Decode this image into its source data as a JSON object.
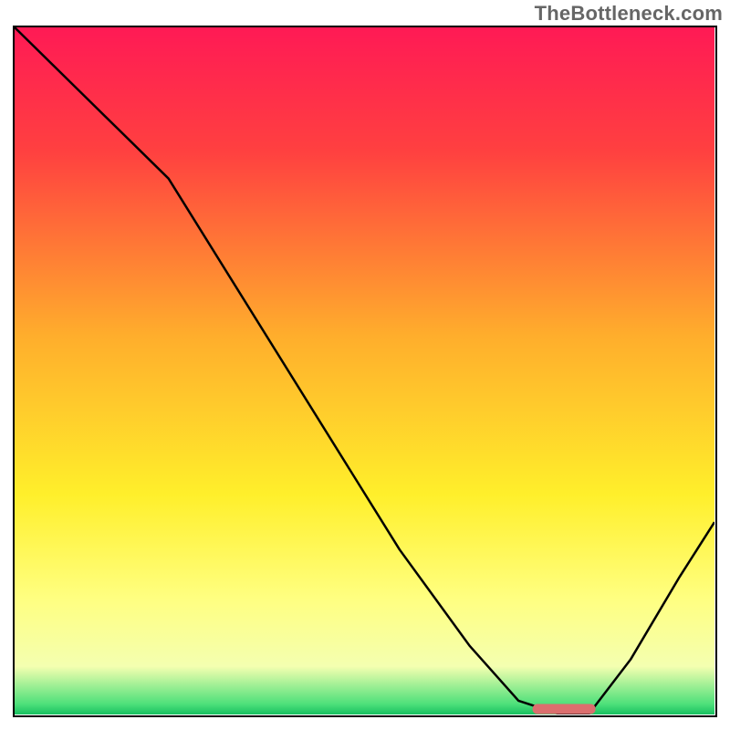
{
  "watermark_text": "TheBottleneck.com",
  "chart_data": {
    "type": "line",
    "title": "",
    "xlabel": "",
    "ylabel": "",
    "xlim": [
      0,
      100
    ],
    "ylim": [
      0,
      100
    ],
    "gradient_stops": [
      {
        "offset": 0.0,
        "color": "#ff1a55"
      },
      {
        "offset": 0.18,
        "color": "#ff4040"
      },
      {
        "offset": 0.45,
        "color": "#ffae2c"
      },
      {
        "offset": 0.68,
        "color": "#ffef2b"
      },
      {
        "offset": 0.83,
        "color": "#ffff80"
      },
      {
        "offset": 0.93,
        "color": "#f4ffb0"
      },
      {
        "offset": 0.985,
        "color": "#4de07a"
      },
      {
        "offset": 1.0,
        "color": "#18c060"
      }
    ],
    "series": [
      {
        "name": "bottleneck-curve",
        "x": [
          0,
          12,
          22,
          55,
          65,
          72,
          78,
          82,
          88,
          95,
          100
        ],
        "y": [
          100,
          88,
          78,
          24,
          10,
          2,
          0,
          0,
          8,
          20,
          28
        ]
      }
    ],
    "marker": {
      "name": "target-bar",
      "x_start": 74,
      "x_end": 83,
      "y": 0.8,
      "color": "#db6e6e"
    },
    "annotations": []
  }
}
